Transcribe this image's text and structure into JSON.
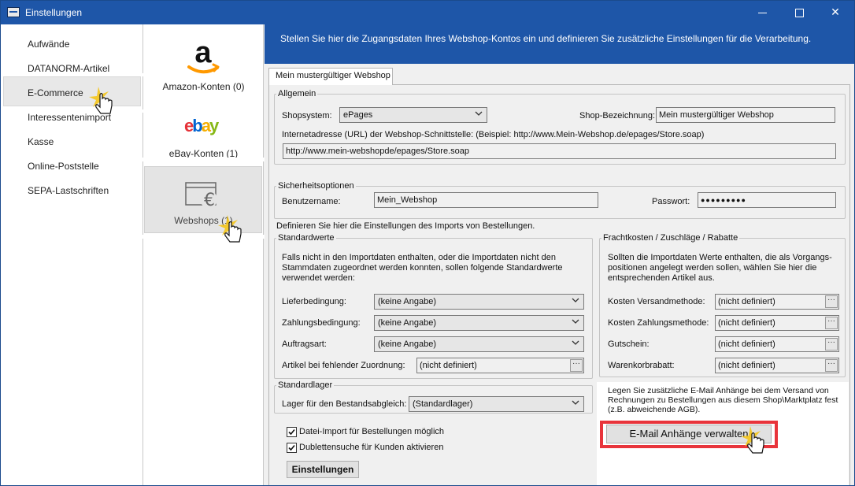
{
  "window": {
    "title": "Einstellungen",
    "controls": [
      "—",
      "□",
      "✕"
    ]
  },
  "sidebar": {
    "items": [
      {
        "label": "Aufwände"
      },
      {
        "label": "DATANORM-Artikel"
      },
      {
        "label": "E-Commerce",
        "selected": true
      },
      {
        "label": "Interessentenimport"
      },
      {
        "label": "Kasse"
      },
      {
        "label": "Online-Poststelle"
      },
      {
        "label": "SEPA-Lastschriften"
      }
    ]
  },
  "accounts": {
    "amazon_label": "Amazon-Konten (0)",
    "ebay_logo": [
      "e",
      "b",
      "a",
      "y"
    ],
    "ebay_label": "eBay-Konten (1)",
    "webshops_label": "Webshops (1)"
  },
  "banner": {
    "text": "Stellen Sie hier die Zugangsdaten Ihres Webshop-Kontos ein und definieren Sie zusätzliche Einstellungen für die Verarbeitung."
  },
  "tab": {
    "label": "Mein mustergültiger Webshop"
  },
  "allgemein": {
    "legend": "Allgemein",
    "shopsystem_label": "Shopsystem:",
    "shopsystem_value": "ePages",
    "bezeichnung_label": "Shop-Bezeichnung:",
    "bezeichnung_value": "Mein mustergültiger Webshop",
    "url_label": "Internetadresse (URL) der Webshop-Schnittstelle: (Beispiel: http://www.Mein-Webshop.de/epages/Store.soap)",
    "url_value": "http://www.mein-webshopde/epages/Store.soap"
  },
  "sicherheit": {
    "legend": "Sicherheitsoptionen",
    "user_label": "Benutzername:",
    "user_value": "Mein_Webshop",
    "pass_label": "Passwort:",
    "pass_value": "●●●●●●●●●"
  },
  "import_intro": "Definieren Sie hier die Einstellungen des Imports von Bestellungen.",
  "standardwerte": {
    "legend": "Standardwerte",
    "description": "Falls nicht in den Importdaten enthalten, oder die Importdaten nicht den Stammdaten zugeordnet werden konnten, sollen folgende Standardwerte verwendet werden:",
    "fields": [
      {
        "label": "Lieferbedingung:",
        "value": "(keine Angabe)"
      },
      {
        "label": "Zahlungsbedingung:",
        "value": "(keine Angabe)"
      },
      {
        "label": "Auftragsart:",
        "value": "(keine Angabe)"
      },
      {
        "label": "Artikel bei fehlender Zuordnung:",
        "value": "(nicht definiert)"
      }
    ]
  },
  "fracht": {
    "legend": "Frachtkosten / Zuschläge / Rabatte",
    "description": "Sollten die Importdaten Werte enthalten, die als Vorgangs-positionen angelegt werden sollen, wählen Sie hier die entsprechenden Artikel aus.",
    "fields": [
      {
        "label": "Kosten Versandmethode:",
        "value": "(nicht definiert)"
      },
      {
        "label": "Kosten Zahlungsmethode:",
        "value": "(nicht definiert)"
      },
      {
        "label": "Gutschein:",
        "value": "(nicht definiert)"
      },
      {
        "label": "Warenkorbrabatt:",
        "value": "(nicht definiert)"
      }
    ]
  },
  "standardlager": {
    "legend": "Standardlager",
    "label": "Lager für den Bestandsabgleich:",
    "value": "(Standardlager)"
  },
  "options": {
    "datei_import": "Datei-Import für Bestellungen möglich",
    "dubletten": "Dublettensuche für Kunden aktivieren",
    "settings_button": "Einstellungen"
  },
  "email": {
    "text": "Legen Sie zusätzliche E-Mail Anhänge bei dem Versand von Rechnungen zu Bestellungen aus diesem Shop\\Marktplatz fest (z.B. abweichende AGB).",
    "button": "E-Mail Anhänge verwalten"
  },
  "colors": {
    "titlebar": "#1e56a8",
    "highlight_red": "#e8343b",
    "cursor_glow": "#f5c518"
  }
}
